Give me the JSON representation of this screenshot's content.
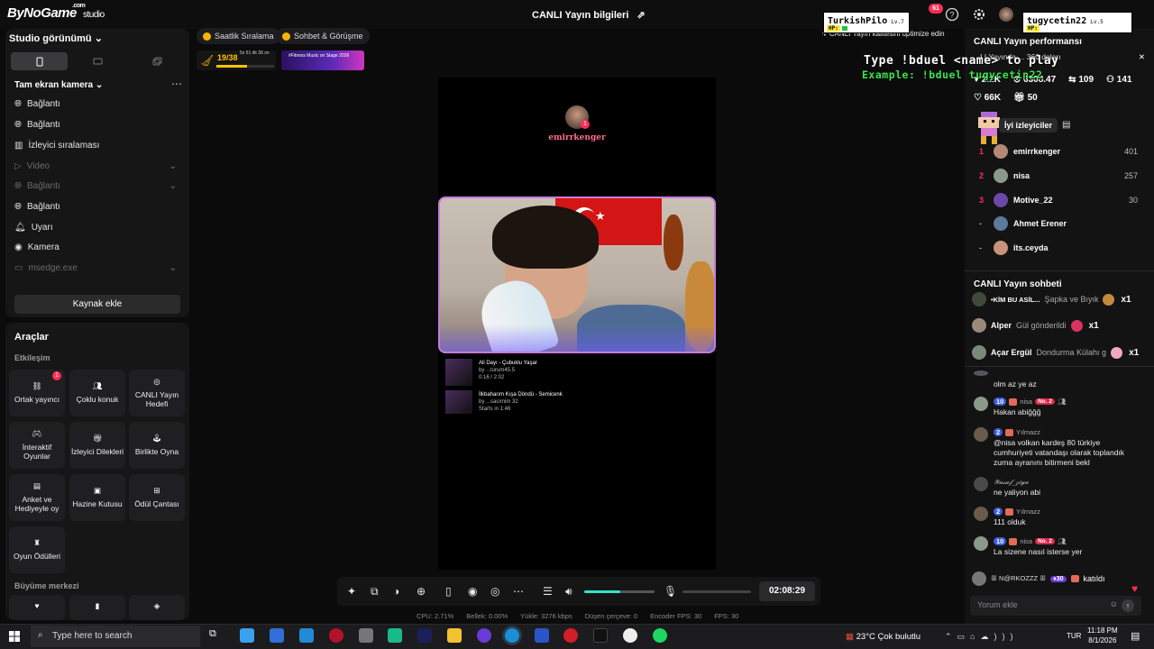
{
  "app": {
    "logo": "ByNoGame",
    "logo_suffix": ".com",
    "app_name": "studio"
  },
  "topbar": {
    "live_info_title": "CANLI Yayın bilgileri",
    "notification_count": "61"
  },
  "studio": {
    "view_label": "Studio görünümü",
    "camera_header": "Tam ekran kamera",
    "sources": [
      {
        "label": "Bağlantı",
        "icon": "globe-icon",
        "dim": false
      },
      {
        "label": "Bağlantı",
        "icon": "globe-icon",
        "dim": false
      },
      {
        "label": "İzleyici sıralaması",
        "icon": "ranking-icon",
        "dim": false
      },
      {
        "label": "Video",
        "icon": "play-icon",
        "dim": true
      },
      {
        "label": "Bağlantı",
        "icon": "globe-icon",
        "dim": true
      },
      {
        "label": "Bağlantı",
        "icon": "globe-icon",
        "dim": false
      },
      {
        "label": "Uyarı",
        "icon": "bell-icon",
        "dim": false
      },
      {
        "label": "Kamera",
        "icon": "camera-icon",
        "dim": false
      },
      {
        "label": "msedge.exe",
        "icon": "window-icon",
        "dim": true
      }
    ],
    "add_source_label": "Kaynak ekle"
  },
  "tools": {
    "title": "Araçlar",
    "interaction_label": "Etkileşim",
    "guest_badge": "1",
    "tiles": [
      {
        "label": "Ortak yayıncı",
        "icon": "link-icon"
      },
      {
        "label": "Çoklu konuk",
        "icon": "people-icon"
      },
      {
        "label": "CANLI Yayın Hedefi",
        "icon": "target-icon"
      },
      {
        "label": "İnteraktif Oyunlar",
        "icon": "gamepad-icon"
      },
      {
        "label": "İzleyici Dilekleri",
        "icon": "gift-icon"
      },
      {
        "label": "Birlikte Oyna",
        "icon": "joystick-icon"
      },
      {
        "label": "Anket ve Hediyeyle oy",
        "icon": "poll-icon"
      },
      {
        "label": "Hazine Kutusu",
        "icon": "chest-icon"
      },
      {
        "label": "Ödül Çantası",
        "icon": "bag-icon"
      },
      {
        "label": "Oyun Ödülleri",
        "icon": "trophy-icon"
      }
    ],
    "growth_label": "Büyüme merkezi"
  },
  "stream": {
    "chips": [
      "Saatlik Sıralama",
      "Sohbet & Görüşme"
    ],
    "progress_count": "19/38",
    "progress_fraction": 0.53,
    "progress_time": "5s 51 dk 36 sn",
    "promo_text": "#Fitness Music on Stage 2026",
    "streamer_name": "emirrkenger",
    "streamer_badge": "1",
    "songs": [
      {
        "title": "Ali Dayı - Çubuklu Yaşar",
        "by": "by  ...turum45.5",
        "time": "0:16 / 2:02"
      },
      {
        "title": "İlkbaharım Kışa Döndü - Semicenk",
        "by": "by  ...sacirnim 32",
        "time": "Starts in 1:46"
      }
    ]
  },
  "controls": {
    "timer": "02:08:29",
    "volume_fraction": 0.51,
    "stats": [
      "CPU: 2.71%",
      "Bellek: 0.00%",
      "Yükle: 3276 kbps",
      "Düşen çerçeve: 0",
      "Encoder FPS: 30",
      "FPS: 30"
    ]
  },
  "overlay": {
    "command": "Type !bduel <name> to play",
    "example": "Example: !bduel tugycetin22",
    "player1": {
      "name": "TurkishPilo",
      "level": "Lv.7",
      "hp_label": "HP:",
      "hp_fraction": 0.08
    },
    "player2": {
      "name": "tugycetin22",
      "level": "Lv.5",
      "hp_label": "HP:",
      "hp_fraction": 0.0
    }
  },
  "performance": {
    "title": "CANLI Yayın performansı",
    "tip": "CANLI Yayın kalitesini optimize edin",
    "notice": "...LI Yayında ... 360 doları",
    "metrics": [
      "2.1K",
      "6308.47",
      "109",
      "141"
    ],
    "metrics2": [
      "66K",
      "50"
    ]
  },
  "top_viewers": {
    "header": "İyi izleyiciler",
    "rows": [
      {
        "rank": "1",
        "name": "emirrkenger",
        "score": "401"
      },
      {
        "rank": "2",
        "name": "nisa",
        "score": "257"
      },
      {
        "rank": "3",
        "name": "Motive_22",
        "score": "30"
      },
      {
        "rank": "-",
        "name": "Ahmet Erener",
        "score": ""
      },
      {
        "rank": "-",
        "name": "its.ceyda",
        "score": ""
      }
    ]
  },
  "chat": {
    "title": "CANLI Yayın sohbeti",
    "gifts": [
      {
        "user": "•KİM BU ASİL...",
        "text": "Şapka ve Bıyık",
        "count": "x1",
        "color": "#c48a3c"
      },
      {
        "user": "Alper",
        "text": "Gül gönderildi",
        "count": "x1",
        "color": "#d8345f"
      },
      {
        "user": "Açar Ergül",
        "text": "Dondurma Külahı g",
        "count": "x1",
        "color": "#f2a7c3"
      }
    ],
    "messages": [
      {
        "user": "",
        "level": "",
        "fan": false,
        "badge": "",
        "text": "olm az ye az"
      },
      {
        "user": "nisa",
        "level": "10",
        "fan": true,
        "badge": "No. 2",
        "text": "Hakan abiğğğ"
      },
      {
        "user": "Yılmazz",
        "level": "2",
        "fan": true,
        "badge": "",
        "text": "@nisa volkan kardeş 80 türkiye cumhuriyeti vatandaşı olarak toplandık zurna ayranını bitirmeni bekl"
      },
      {
        "user": "𝒴𝓊𝓈𝓊𝒻_𝓏𝒾𝓎𝒶",
        "level": "",
        "fan": false,
        "badge": "",
        "text": "ne yaliyon abi"
      },
      {
        "user": "Yılmazz",
        "level": "2",
        "fan": true,
        "badge": "",
        "text": "111 olduk"
      },
      {
        "user": "nisa",
        "level": "10",
        "fan": true,
        "badge": "No. 2",
        "text": "La sizene nasıl isterse yer"
      }
    ],
    "join": {
      "user": "ꕥ N@RKOZZZ ꕥ",
      "level": "30",
      "text": "katıldı"
    },
    "comment_placeholder": "Yorum ekle"
  },
  "taskbar": {
    "search_placeholder": "Type here to search",
    "weather": "23°C  Çok bulutlu",
    "lang": "TUR",
    "time": "11:18 PM",
    "date": "8/1/2026"
  }
}
